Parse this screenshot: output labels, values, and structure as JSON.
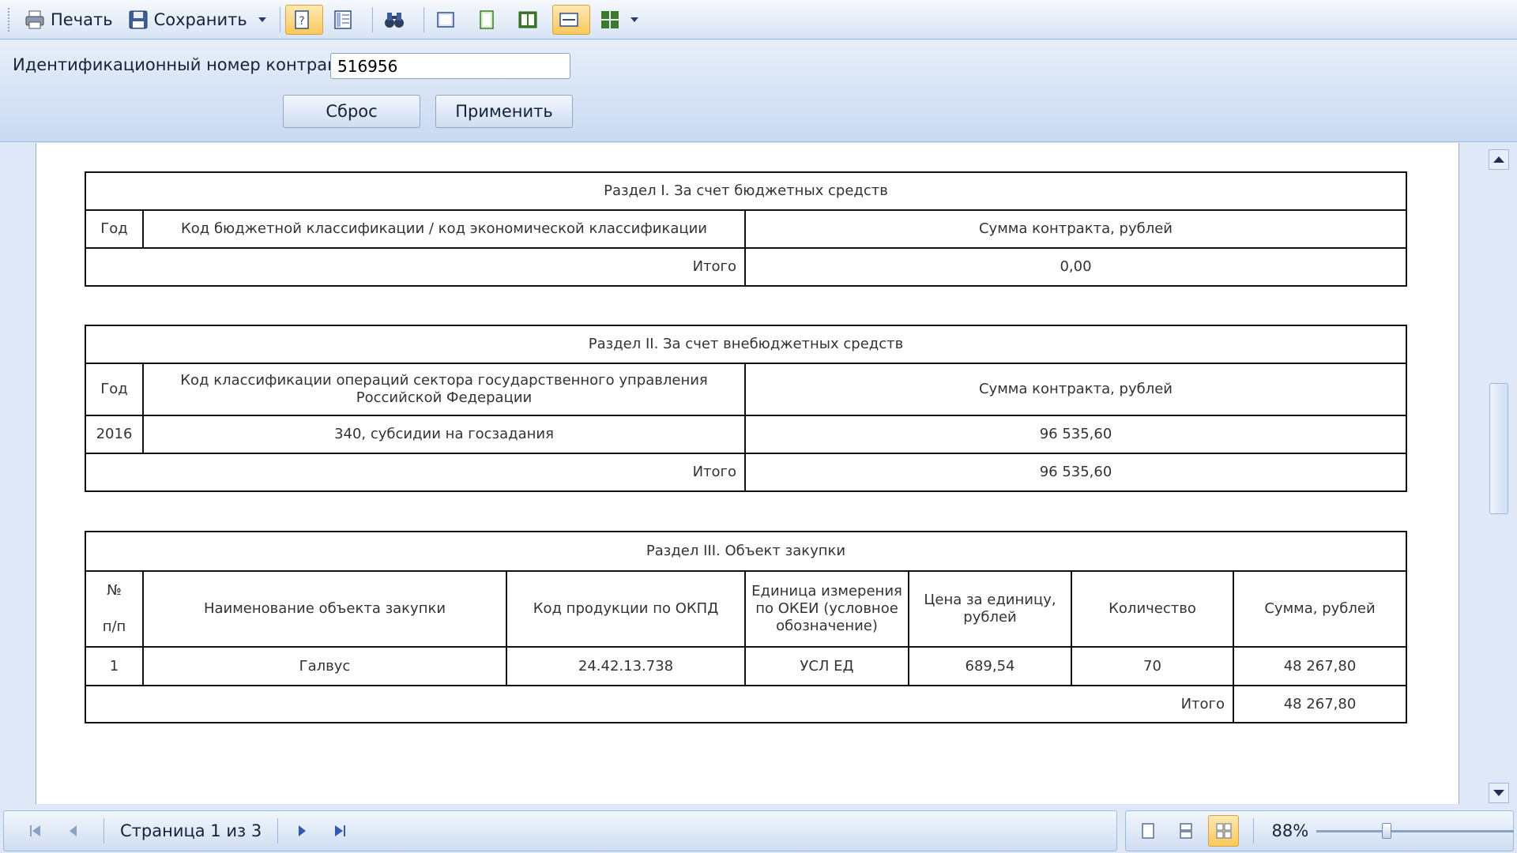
{
  "toolbar": {
    "print_label": "Печать",
    "save_label": "Сохранить"
  },
  "params": {
    "contract_id_label": "Идентификационный номер контракта",
    "contract_id_value": "516956",
    "reset_label": "Сброс",
    "apply_label": "Применить"
  },
  "section1": {
    "title": "Раздел I. За счет бюджетных средств",
    "col_year": "Год",
    "col_code": "Код бюджетной классификации / код экономической классификации",
    "col_sum": "Сумма контракта, рублей",
    "total_label": "Итого",
    "total_value": "0,00"
  },
  "section2": {
    "title": "Раздел II. За счет внебюджетных средств",
    "col_year": "Год",
    "col_code": "Код классификации операций сектора государственного управления Российской Федерации",
    "col_sum": "Сумма контракта, рублей",
    "rows": [
      {
        "year": "2016",
        "code": "340, субсидии на госзадания",
        "sum": "96 535,60"
      }
    ],
    "total_label": "Итого",
    "total_value": "96 535,60"
  },
  "section3": {
    "title": "Раздел III. Объект закупки",
    "col_num_top": "№",
    "col_num_bottom": "п/п",
    "col_name": "Наименование объекта закупки",
    "col_okpd": "Код продукции по ОКПД",
    "col_unit": "Единица измерения по ОКЕИ (условное обозначение)",
    "col_price": "Цена за единицу, рублей",
    "col_qty": "Количество",
    "col_sum": "Сумма, рублей",
    "rows": [
      {
        "num": "1",
        "name": "Галвус",
        "okpd": "24.42.13.738",
        "unit": "УСЛ ЕД",
        "price": "689,54",
        "qty": "70",
        "sum": "48 267,80"
      }
    ],
    "total_label": "Итого",
    "total_value": "48 267,80"
  },
  "statusbar": {
    "page_info": "Страница 1 из 3",
    "zoom": "88%",
    "zoom_fraction": 0.35
  }
}
